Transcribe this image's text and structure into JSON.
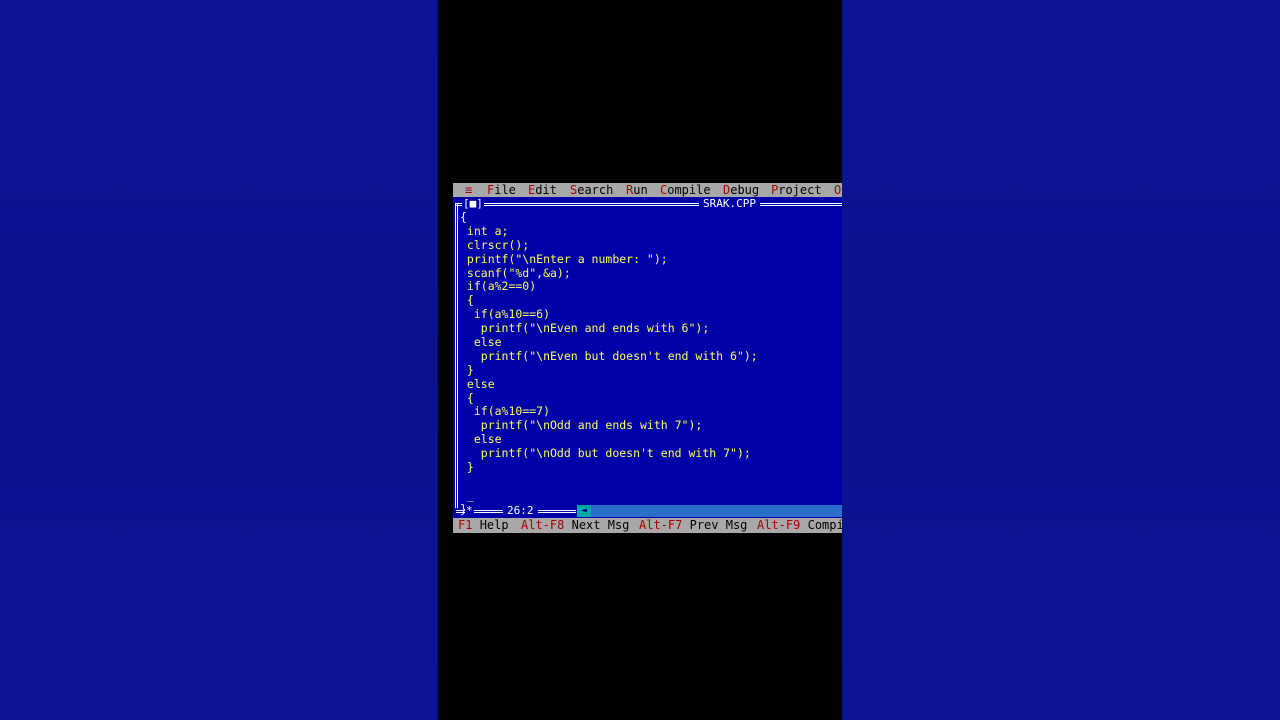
{
  "menu": {
    "system": "≡",
    "items": [
      {
        "hot": "F",
        "rest": "ile"
      },
      {
        "hot": "E",
        "rest": "dit"
      },
      {
        "hot": "S",
        "rest": "earch"
      },
      {
        "hot": "R",
        "rest": "un"
      },
      {
        "hot": "C",
        "rest": "ompile"
      },
      {
        "hot": "D",
        "rest": "ebug"
      },
      {
        "hot": "P",
        "rest": "roject"
      },
      {
        "hot": "O",
        "rest": ""
      }
    ]
  },
  "window": {
    "close_box": "[■]",
    "title": "SRAK.CPP",
    "cursor_position": "26:2",
    "modified_marker": "*",
    "scroll_arrow": "◄"
  },
  "code_lines": [
    "{",
    " int a;",
    " clrscr();",
    " printf(\"\\nEnter a number: \");",
    " scanf(\"%d\",&a);",
    " if(a%2==0)",
    " {",
    "  if(a%10==6)",
    "   printf(\"\\nEven and ends with 6\");",
    "  else",
    "   printf(\"\\nEven but doesn't end with 6\");",
    " }",
    " else",
    " {",
    "  if(a%10==7)",
    "   printf(\"\\nOdd and ends with 7\");",
    "  else",
    "   printf(\"\\nOdd but doesn't end with 7\");",
    " }",
    "",
    " _",
    "}"
  ],
  "helpbar": [
    {
      "key": "F1",
      "label": "Help"
    },
    {
      "key": "Alt-F8",
      "label": "Next Msg"
    },
    {
      "key": "Alt-F7",
      "label": "Prev Msg"
    },
    {
      "key": "Alt-F9",
      "label": "Compi"
    }
  ],
  "colors": {
    "editor_bg": "#0000a8",
    "code_text": "#ffff55",
    "menu_bg": "#a8a8a8",
    "hotkey": "#a80000",
    "backdrop": "#0c1390"
  }
}
